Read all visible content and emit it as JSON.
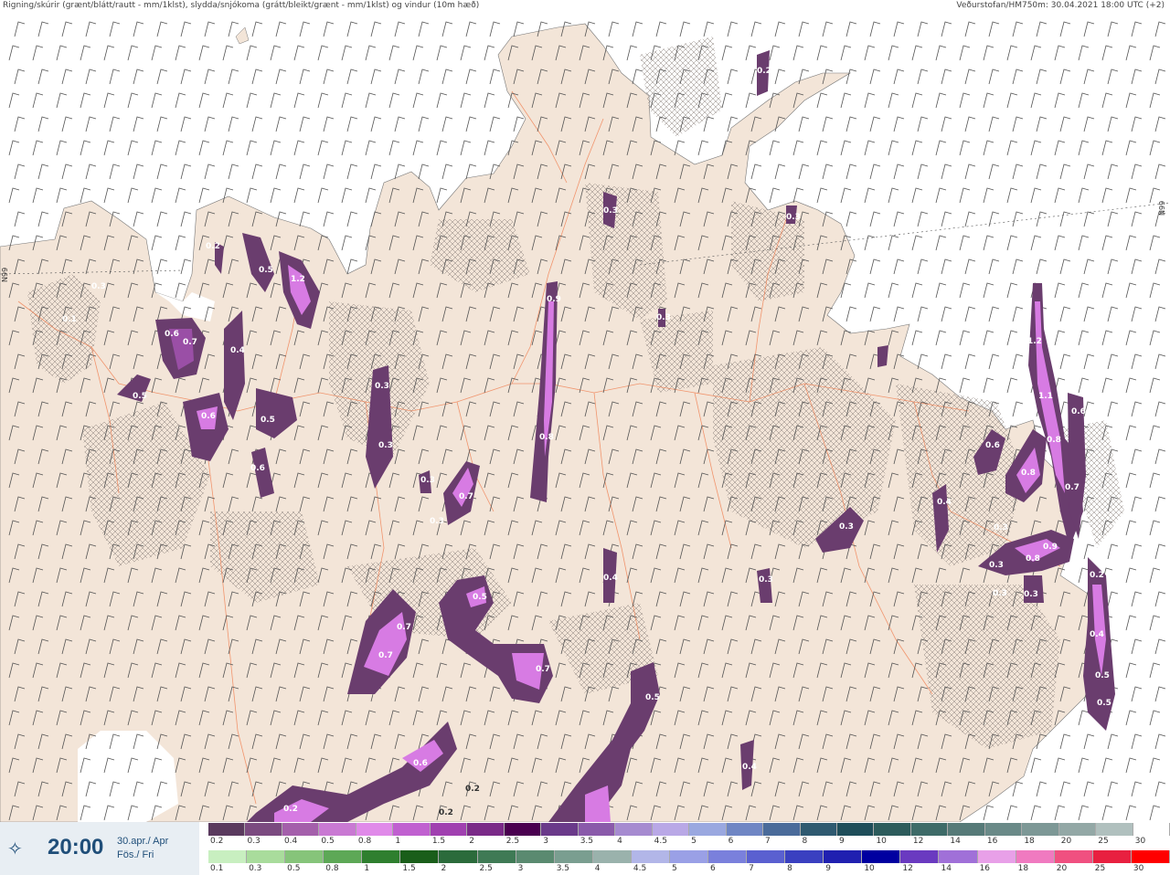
{
  "header": {
    "left": "Rigning/skúrir (grænt/blátt/rautt - mm/1klst), slydda/snjókoma (grátt/bleikt/grænt - mm/1klst) og vindur (10m hæð)",
    "right": "Veðurstofan/HM750m: 30.04.2021 18:00 UTC (+2)"
  },
  "map": {
    "colors": {
      "sea": "#ffffff",
      "land": "#f3e5d8",
      "road": "#f07a4a",
      "snow_dark": "#6a3d6e",
      "snow_mid": "#9a4fa6",
      "snow_light": "#d77be3"
    },
    "grid_label_left": "N99",
    "grid_label_right": "N99",
    "precip_labels": [
      "0.1",
      "0.3",
      "0.6",
      "0.7",
      "0.4",
      "0.2",
      "0.5",
      "1.2",
      "0.5",
      "0.6",
      "0.5",
      "0.6",
      "0.3",
      "0.3",
      "0.3",
      "0.7",
      "0.3",
      "0.9",
      "0.8",
      "0.3",
      "0.3",
      "0.2",
      "0.3",
      "0.4",
      "0.3",
      "0.3",
      "1.2",
      "1.1",
      "0.6",
      "0.8",
      "0.8",
      "0.7",
      "0.4",
      "0.6",
      "0.3",
      "0.3",
      "0.8",
      "0.9",
      "0.3",
      "0.3",
      "0.2",
      "0.4",
      "0.5",
      "0.5",
      "0.7",
      "0.7",
      "0.5",
      "0.7",
      "0.5",
      "0.6",
      "0.2",
      "0.2",
      "0.2",
      "0.4",
      "0.3"
    ]
  },
  "legend": {
    "scale1_labels": [
      "0.2",
      "0.3",
      "0.4",
      "0.5",
      "0.8",
      "1",
      "1.5",
      "2",
      "2.5",
      "3",
      "3.5",
      "4",
      "4.5",
      "5",
      "6",
      "7",
      "8",
      "9",
      "10",
      "12",
      "14",
      "16",
      "18",
      "20",
      "25",
      "30"
    ],
    "scale1_colors": [
      "#5a3a5e",
      "#7b4a80",
      "#a45fab",
      "#c979d3",
      "#e08ae9",
      "#c060d0",
      "#a040b0",
      "#7a2a88",
      "#4a0050",
      "#6a3a8a",
      "#8a5aaa",
      "#a68bd0",
      "#b9a8e6",
      "#9aa8e0",
      "#6f86c4",
      "#4a6b9a",
      "#2f5a70",
      "#1f4e5a",
      "#2d5c5c",
      "#3e6b68",
      "#567a78",
      "#6a8a88",
      "#7d9896",
      "#93a8a6",
      "#b0c0be",
      "#ffffff"
    ],
    "scale2_labels": [
      "0.1",
      "0.3",
      "0.5",
      "0.8",
      "1",
      "1.5",
      "2",
      "2.5",
      "3",
      "3.5",
      "4",
      "4.5",
      "5",
      "6",
      "7",
      "8",
      "9",
      "10",
      "12",
      "14",
      "16",
      "18",
      "20",
      "25",
      "30"
    ],
    "scale2_colors": [
      "#c8efc0",
      "#a9dc9c",
      "#86c47a",
      "#5da856",
      "#2f7f2f",
      "#1a5e1a",
      "#2b6b3b",
      "#3f7a55",
      "#5a8a70",
      "#7a9e90",
      "#9ab2ac",
      "#b2b6e8",
      "#9aa0e6",
      "#7a80dc",
      "#5a60d0",
      "#3a40c0",
      "#2020b0",
      "#0000a0",
      "#6a3ac0",
      "#a070d8",
      "#e8a0e8",
      "#f07ac0",
      "#f05080",
      "#e82040",
      "#ff0000"
    ]
  },
  "time": {
    "value": "20:00",
    "date_line1": "30.apr./ Apr",
    "date_line2": "Fös./ Fri",
    "icon": "compass-star-icon"
  }
}
